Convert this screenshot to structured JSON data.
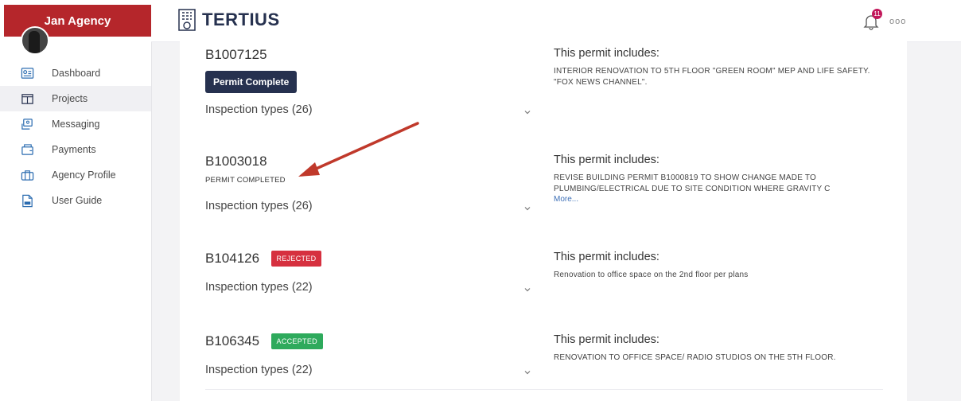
{
  "agency": {
    "name": "Jan Agency"
  },
  "brand": {
    "name": "TERTIUS"
  },
  "notifications": {
    "count": "11",
    "more": "ooo"
  },
  "nav": [
    {
      "label": "Dashboard",
      "icon": "dashboard-icon"
    },
    {
      "label": "Projects",
      "icon": "projects-icon",
      "active": true
    },
    {
      "label": "Messaging",
      "icon": "messaging-icon"
    },
    {
      "label": "Payments",
      "icon": "payments-icon"
    },
    {
      "label": "Agency Profile",
      "icon": "agency-profile-icon"
    },
    {
      "label": "User Guide",
      "icon": "pdf-icon"
    }
  ],
  "permits": [
    {
      "id": "B1007125",
      "status_button": "Permit Complete",
      "inspection": "Inspection types (26)",
      "desc_title": "This permit includes:",
      "desc_body": "INTERIOR RENOVATION TO 5TH FLOOR \"GREEN ROOM\" MEP AND LIFE SAFETY. \"FOX NEWS CHANNEL\"."
    },
    {
      "id": "B1003018",
      "status_text": "PERMIT COMPLETED",
      "inspection": "Inspection types (26)",
      "desc_title": "This permit includes:",
      "desc_body": "REVISE BUILDING PERMIT B1000819 TO SHOW CHANGE MADE TO PLUMBING/ELECTRICAL DUE TO SITE CONDITION WHERE GRAVITY C",
      "more": "More..."
    },
    {
      "id": "B104126",
      "badge": "REJECTED",
      "badge_color": "#d6303f",
      "inspection": "Inspection types (22)",
      "desc_title": "This permit includes:",
      "desc_body": "Renovation to office space on the 2nd floor per plans"
    },
    {
      "id": "B106345",
      "badge": "ACCEPTED",
      "badge_color": "#2eaa5c",
      "inspection": "Inspection types (22)",
      "desc_title": "This permit includes:",
      "desc_body": "RENOVATION TO OFFICE SPACE/ RADIO STUDIOS ON THE 5TH FLOOR."
    }
  ],
  "colors": {
    "agency_red": "#b5262b",
    "navy": "#26314f",
    "annotation_arrow": "#c0392b"
  }
}
